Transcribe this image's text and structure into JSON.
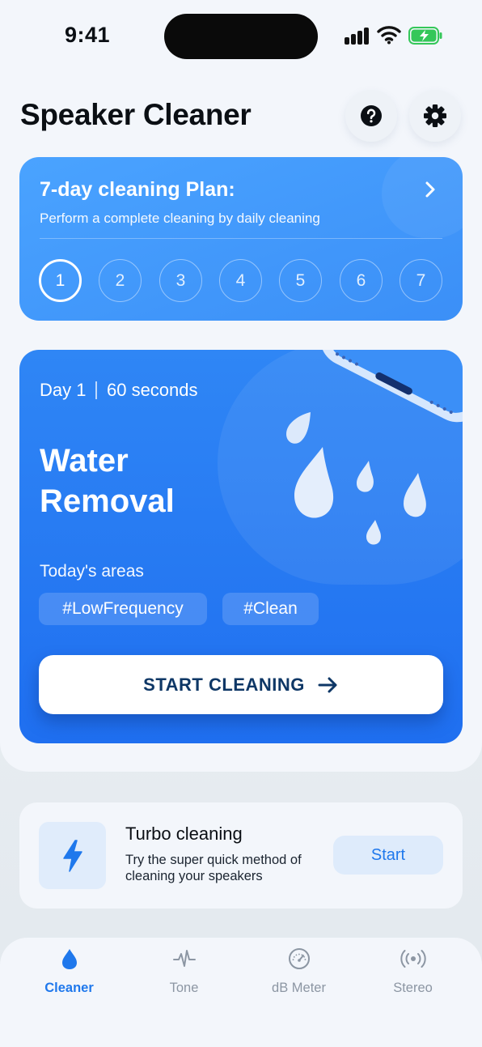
{
  "status_bar": {
    "time": "9:41"
  },
  "header": {
    "title": "Speaker Cleaner"
  },
  "plan": {
    "title": "7-day cleaning Plan:",
    "subtitle": "Perform a complete cleaning by daily cleaning",
    "days": [
      "1",
      "2",
      "3",
      "4",
      "5",
      "6",
      "7"
    ],
    "active_day": "1"
  },
  "session": {
    "day": "Day 1",
    "duration": "60 seconds",
    "title_line1": "Water",
    "title_line2": "Removal",
    "areas_label": "Today's areas",
    "tags": [
      "#LowFrequency",
      "#Clean"
    ],
    "start_label": "START CLEANING"
  },
  "turbo": {
    "title": "Turbo cleaning",
    "description": "Try the super quick method of cleaning your speakers",
    "start_label": "Start"
  },
  "tabs": [
    {
      "label": "Cleaner",
      "icon": "water-drop-icon",
      "active": true
    },
    {
      "label": "Tone",
      "icon": "waveform-icon",
      "active": false
    },
    {
      "label": "dB Meter",
      "icon": "gauge-icon",
      "active": false
    },
    {
      "label": "Stereo",
      "icon": "broadcast-icon",
      "active": false
    }
  ],
  "colors": {
    "accent": "#1f78ec",
    "plan_card": "#3b8ff7",
    "main_card": "#1f6ff0",
    "battery": "#34c759"
  }
}
